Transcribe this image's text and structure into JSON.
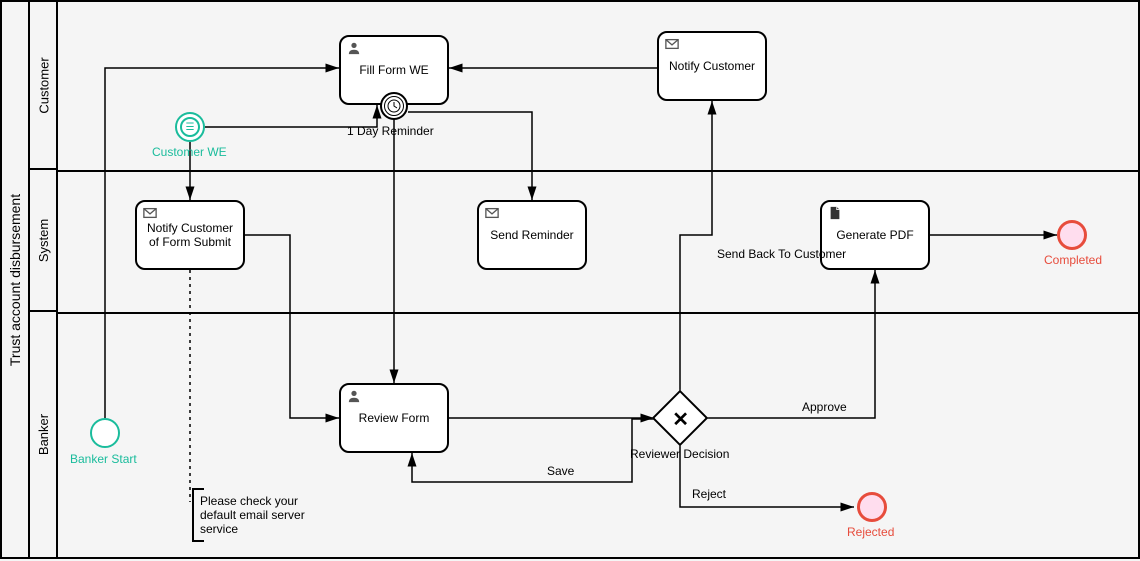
{
  "pool": {
    "name": "Trust account disbursement"
  },
  "lanes": {
    "customer": "Customer",
    "system": "System",
    "banker": "Banker"
  },
  "events": {
    "banker_start": "Banker Start",
    "customer_we": "Customer WE",
    "rejected": "Rejected",
    "completed": "Completed",
    "timer": "1 Day Reminder"
  },
  "tasks": {
    "fill_form": "Fill Form WE",
    "notify_customer": "Notify Customer",
    "notify_submit": "Notify Customer of Form Submit",
    "send_reminder": "Send Reminder",
    "generate_pdf": "Generate PDF",
    "review_form": "Review Form"
  },
  "gateway": {
    "reviewer_decision": "Reviewer Decision"
  },
  "flows": {
    "send_back": "Send Back To Customer",
    "approve": "Approve",
    "reject": "Reject",
    "save": "Save"
  },
  "annotation": {
    "email_note": "Please check your default email server service"
  }
}
